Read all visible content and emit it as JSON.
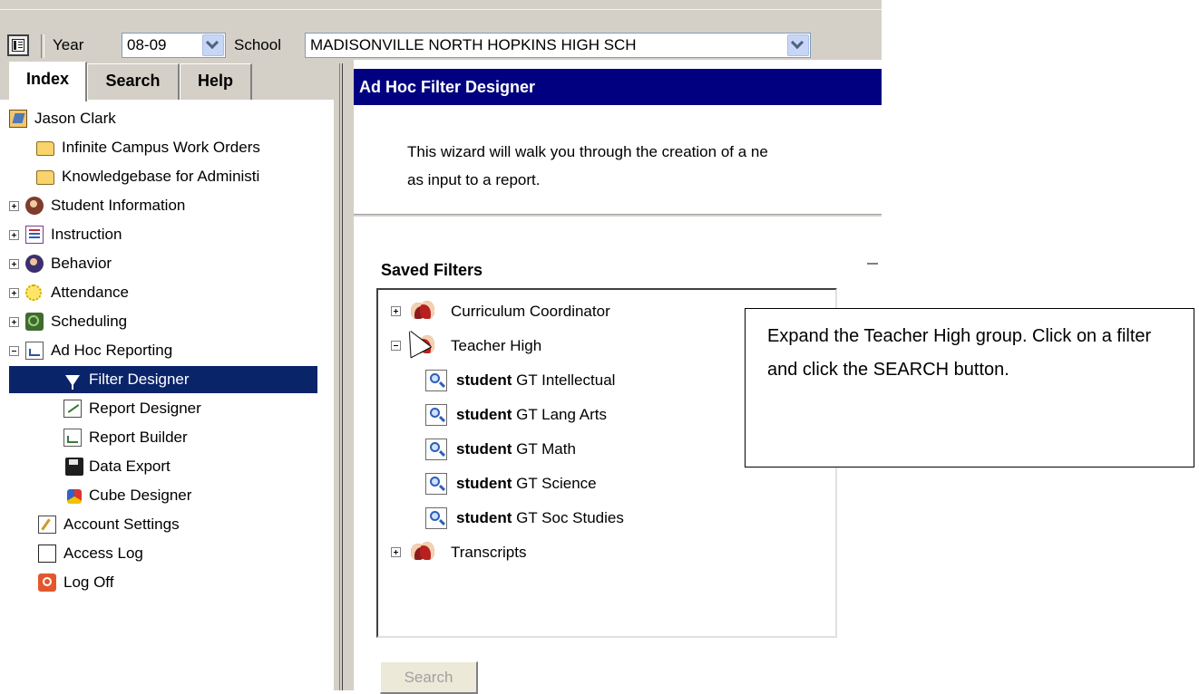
{
  "toolbar": {
    "year_label": "Year",
    "year_value": "08-09",
    "school_label": "School",
    "school_value": "MADISONVILLE NORTH HOPKINS HIGH SCH"
  },
  "tabs": [
    "Index",
    "Search",
    "Help"
  ],
  "tree": {
    "user": "Jason Clark",
    "items": [
      {
        "label": "Infinite Campus Work Orders",
        "icon": "folder-icon"
      },
      {
        "label": "Knowledgebase for Administi",
        "icon": "folder-icon"
      },
      {
        "label": "Student Information",
        "icon": "student-icon",
        "expander": "plus"
      },
      {
        "label": "Instruction",
        "icon": "instruction-icon",
        "expander": "plus"
      },
      {
        "label": "Behavior",
        "icon": "behavior-icon",
        "expander": "plus"
      },
      {
        "label": "Attendance",
        "icon": "attendance-icon",
        "expander": "plus"
      },
      {
        "label": "Scheduling",
        "icon": "scheduling-icon",
        "expander": "plus"
      },
      {
        "label": "Ad Hoc Reporting",
        "icon": "adhoc-icon",
        "expander": "minus"
      },
      {
        "label": "Filter Designer",
        "icon": "funnel-icon",
        "selected": true
      },
      {
        "label": "Report Designer",
        "icon": "report-designer-icon"
      },
      {
        "label": "Report Builder",
        "icon": "report-builder-icon"
      },
      {
        "label": "Data Export",
        "icon": "floppy-disk-icon"
      },
      {
        "label": "Cube Designer",
        "icon": "cube-icon"
      },
      {
        "label": "Account Settings",
        "icon": "account-settings-icon"
      },
      {
        "label": "Access Log",
        "icon": "document-icon"
      },
      {
        "label": "Log Off",
        "icon": "power-icon"
      }
    ]
  },
  "designer": {
    "title": "Ad Hoc Filter Designer",
    "intro_line1": "This wizard will walk you through the creation of a ne",
    "intro_line2": "as input to a report.",
    "saved_filters_label": "Saved Filters",
    "search_button": "Search",
    "filters": [
      {
        "label": "Curriculum Coordinator",
        "type": "group",
        "expander": "plus"
      },
      {
        "label": "Teacher High",
        "type": "group",
        "expander": "minus"
      },
      {
        "prefix": "student",
        "label": "GT Intellectual",
        "type": "filter"
      },
      {
        "prefix": "student",
        "label": "GT Lang Arts",
        "type": "filter"
      },
      {
        "prefix": "student",
        "label": "GT Math",
        "type": "filter"
      },
      {
        "prefix": "student",
        "label": "GT Science",
        "type": "filter"
      },
      {
        "prefix": "student",
        "label": "GT Soc Studies",
        "type": "filter"
      },
      {
        "label": "Transcripts",
        "type": "group",
        "expander": "plus"
      }
    ]
  },
  "callout": {
    "text": "Expand the Teacher High group. Click on a filter and click the SEARCH button."
  },
  "colors": {
    "title_bar": "#000080",
    "selection": "#0a246a",
    "chrome": "#d4d0c8"
  }
}
